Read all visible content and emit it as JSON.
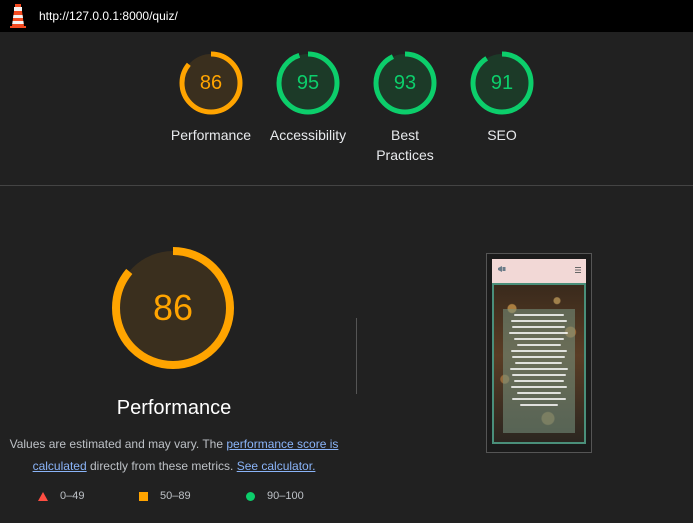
{
  "topbar": {
    "url": "http://127.0.0.1:8000/quiz/",
    "logo_icon": "lighthouse-icon"
  },
  "scores": [
    {
      "label": "Performance",
      "score": 86,
      "color": "#ffa400"
    },
    {
      "label": "Accessibility",
      "score": 95,
      "color": "#0cce6b"
    },
    {
      "label": "Best Practices",
      "score": 93,
      "color": "#0cce6b"
    },
    {
      "label": "SEO",
      "score": 91,
      "color": "#0cce6b"
    }
  ],
  "main": {
    "score": 86,
    "color": "#ffa400",
    "label": "Performance",
    "desc_prefix": "Values are estimated and may vary. The ",
    "link1": "performance score is calculated",
    "desc_middle": " directly from these metrics. ",
    "link2": "See calculator."
  },
  "legend": [
    {
      "shape": "triangle",
      "text": "0–49",
      "color": "#ff4e42"
    },
    {
      "shape": "square",
      "text": "50–89",
      "color": "#ffa400"
    },
    {
      "shape": "circle",
      "text": "90–100",
      "color": "#0cce6b"
    }
  ]
}
